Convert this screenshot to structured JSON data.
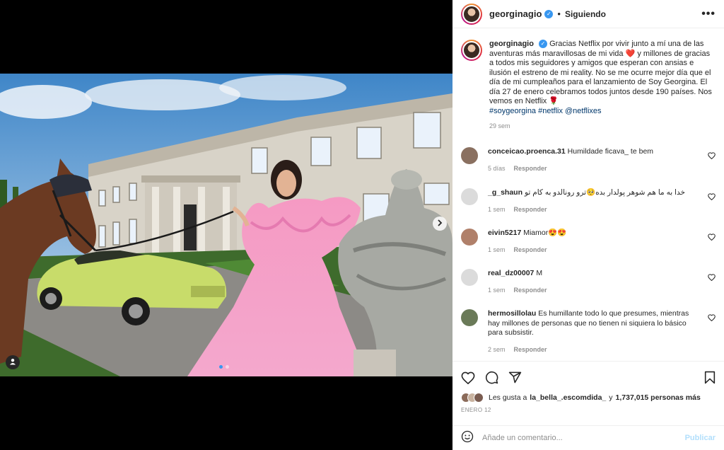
{
  "post": {
    "username": "georginagio",
    "follow_state": "Siguiendo",
    "separator": "•",
    "more_glyph": "•••",
    "caption": {
      "username": "georginagio",
      "text_1": "Gracias Netflix por vivir junto a mí una de las aventuras más maravillosas de mi vida",
      "emoji_1": "❤️",
      "text_2": "y millones de gracias a todos mis seguidores y amigos que esperan con ansias e ilusión el estreno de mi reality. No se me ocurre mejor día que el día de mi cumpleaños para el lanzamiento de Soy Georgina. El día 27 de enero celebramos todos juntos desde 190 países. Nos vemos en Netflix",
      "emoji_2": "🌹",
      "hashtags": "#soygeorgina #netflix @netflixes",
      "age": "29 sem"
    },
    "comments": [
      {
        "user": "conceicao.proenca.31",
        "text": "Humildade ficava_ te bem",
        "age": "5 días",
        "reply": "Responder",
        "avatar_color": "#8a7060"
      },
      {
        "user": "_g_shaun",
        "text": "خدا به ما هم شوهر پولدار بده🥺ترو رونالدو به کام تو",
        "age": "1 sem",
        "reply": "Responder",
        "avatar_color": "#dbdbdb"
      },
      {
        "user": "eivin5217",
        "text": "Miamor😍😍",
        "age": "1 sem",
        "reply": "Responder",
        "avatar_color": "#b0806a"
      },
      {
        "user": "real_dz00007",
        "text": "M",
        "age": "1 sem",
        "reply": "Responder",
        "avatar_color": "#dbdbdb"
      },
      {
        "user": "hermosillolau",
        "text": "Es humillante todo lo que presumes, mientras hay millones de personas que no tienen ni siquiera lo básico para subsistir.",
        "age": "2 sem",
        "reply": "Responder",
        "avatar_color": "#6a7a58"
      }
    ],
    "likes": {
      "prefix": "Les gusta a",
      "user": "la_bella_.escomdida_",
      "middle": "y",
      "count": "1,737,015 personas más"
    },
    "date": "ENERO 12",
    "add_comment": {
      "placeholder": "Añade un comentario...",
      "publish_label": "Publicar"
    },
    "carousel": {
      "slides": 2,
      "active_index": 0
    }
  },
  "icons": {
    "like": "heart-icon",
    "comment": "comment-icon",
    "share": "send-icon",
    "save": "bookmark-icon",
    "emoji": "emoji-icon",
    "tag": "user-tag-icon",
    "next": "chevron-right-icon"
  },
  "colors": {
    "verified": "#3897f0",
    "link": "#00376b",
    "publish_disabled": "#b2dffc",
    "carousel_active": "#3897f0"
  }
}
